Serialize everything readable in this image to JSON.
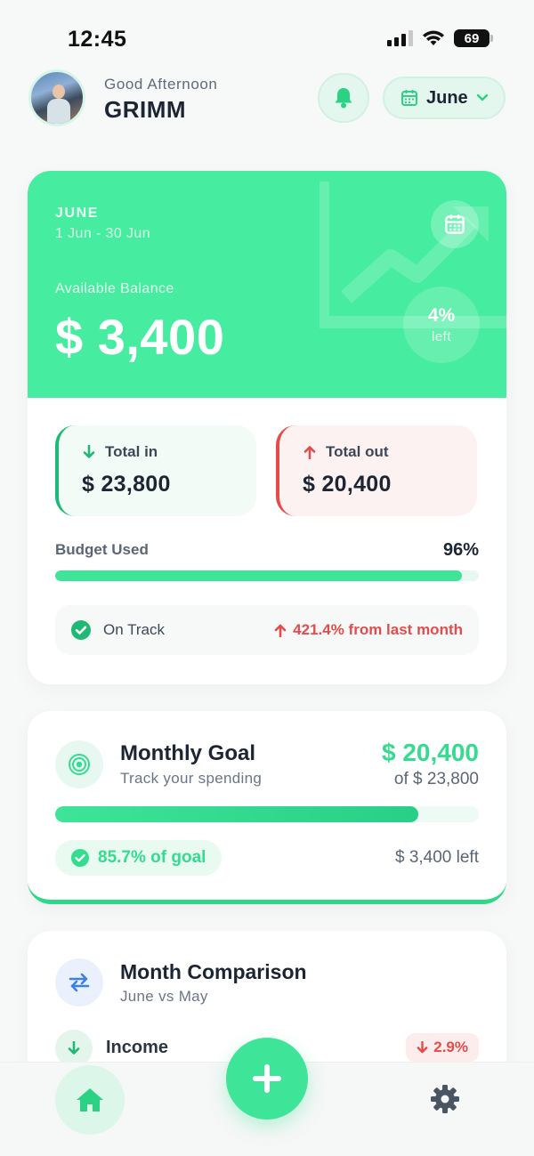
{
  "status_bar": {
    "time": "12:45",
    "battery": "69"
  },
  "header": {
    "greeting": "Good Afternoon",
    "username": "GRIMM",
    "month_selector": "June",
    "icons": {
      "bell": "bell-icon",
      "calendar": "calendar-icon",
      "chevron": "chevron-down-icon"
    }
  },
  "balance_card": {
    "period_month": "JUNE",
    "period_range": "1 Jun - 30 Jun",
    "available_label": "Available Balance",
    "available_amount": "$ 3,400",
    "left_percent": "4%",
    "left_label": "left",
    "total_in": {
      "label": "Total in",
      "amount": "$ 23,800"
    },
    "total_out": {
      "label": "Total out",
      "amount": "$ 20,400"
    },
    "budget": {
      "label": "Budget Used",
      "percent_text": "96%",
      "fraction": 0.96
    },
    "status": {
      "text": "On Track",
      "change": "421.4% from last month"
    }
  },
  "goal_card": {
    "title": "Monthly Goal",
    "subtitle": "Track your spending",
    "amount": "$ 20,400",
    "of_text": "of $ 23,800",
    "fraction": 0.857,
    "badge": "85.7% of goal",
    "left_text": "$ 3,400 left"
  },
  "comparison_card": {
    "title": "Month Comparison",
    "subtitle": "June vs May",
    "income_label": "Income",
    "income_change": "2.9%"
  },
  "bottom_nav": {
    "home": "home-icon",
    "add": "plus-icon",
    "settings": "gear-icon"
  },
  "colors": {
    "accent": "#46ec9f",
    "accent_dark": "#1fb874",
    "danger": "#e14d4d",
    "text_primary": "#1c2533",
    "text_secondary": "#5a6676"
  }
}
